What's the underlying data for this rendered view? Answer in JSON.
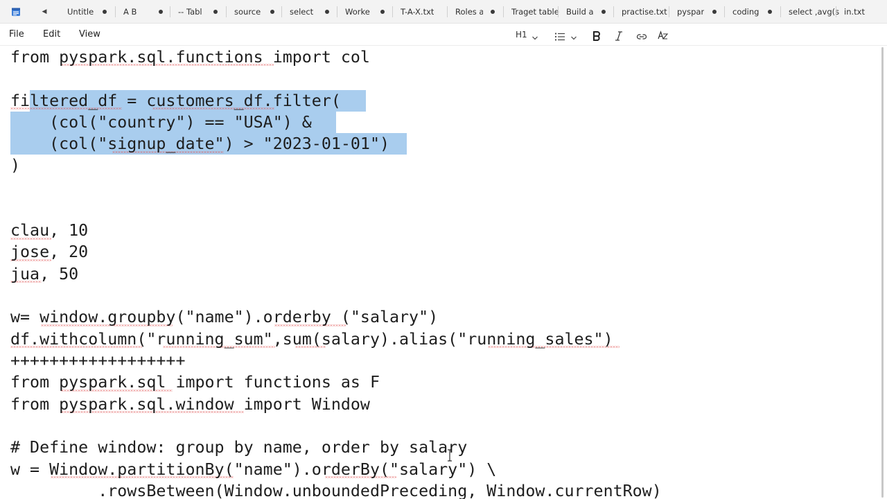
{
  "tabs": [
    {
      "label": "Untitle",
      "modified": true
    },
    {
      "label": "A B",
      "modified": true
    },
    {
      "label": "-- Tabl",
      "modified": true
    },
    {
      "label": "source",
      "modified": true
    },
    {
      "label": "select",
      "modified": true
    },
    {
      "label": "Worke",
      "modified": true
    },
    {
      "label": "T-A-X.txt",
      "modified": false
    },
    {
      "label": "Roles a",
      "modified": true
    },
    {
      "label": "Traget table",
      "modified": false
    },
    {
      "label": "Build a",
      "modified": true
    },
    {
      "label": "practise.txt",
      "modified": false
    },
    {
      "label": "pyspar",
      "modified": true
    },
    {
      "label": "coding",
      "modified": true
    },
    {
      "label": "select ,avg(s",
      "modified": false
    },
    {
      "label": "in.txt",
      "modified": false
    }
  ],
  "menu": {
    "file": "File",
    "edit": "Edit",
    "view": "View"
  },
  "toolbar": {
    "heading": "H1"
  },
  "editor": {
    "lines": [
      "from pyspark.sql.functions import col",
      "",
      "filtered_df = customers_df.filter(",
      "    (col(\"country\") == \"USA\") &",
      "    (col(\"signup_date\") > \"2023-01-01\")",
      ")",
      "",
      "",
      "clau, 10",
      "jose, 20",
      "jua, 50",
      "",
      "w= window.groupby(\"name\").orderby (\"salary\")",
      "df.withcolumn(\"running_sum\",sum(salary).alias(\"running_sales\")",
      "++++++++++++++++++",
      "from pyspark.sql import functions as F",
      "from pyspark.sql.window import Window",
      "",
      "# Define window: group by name, order by salary",
      "w = Window.partitionBy(\"name\").orderBy(\"salary\") \\",
      "         .rowsBetween(Window.unboundedPreceding, Window.currentRow)"
    ]
  },
  "colors": {
    "selection": "#a9cdee",
    "spellcheck": "#e05050",
    "tabbar_bg": "#f3f3f3"
  }
}
